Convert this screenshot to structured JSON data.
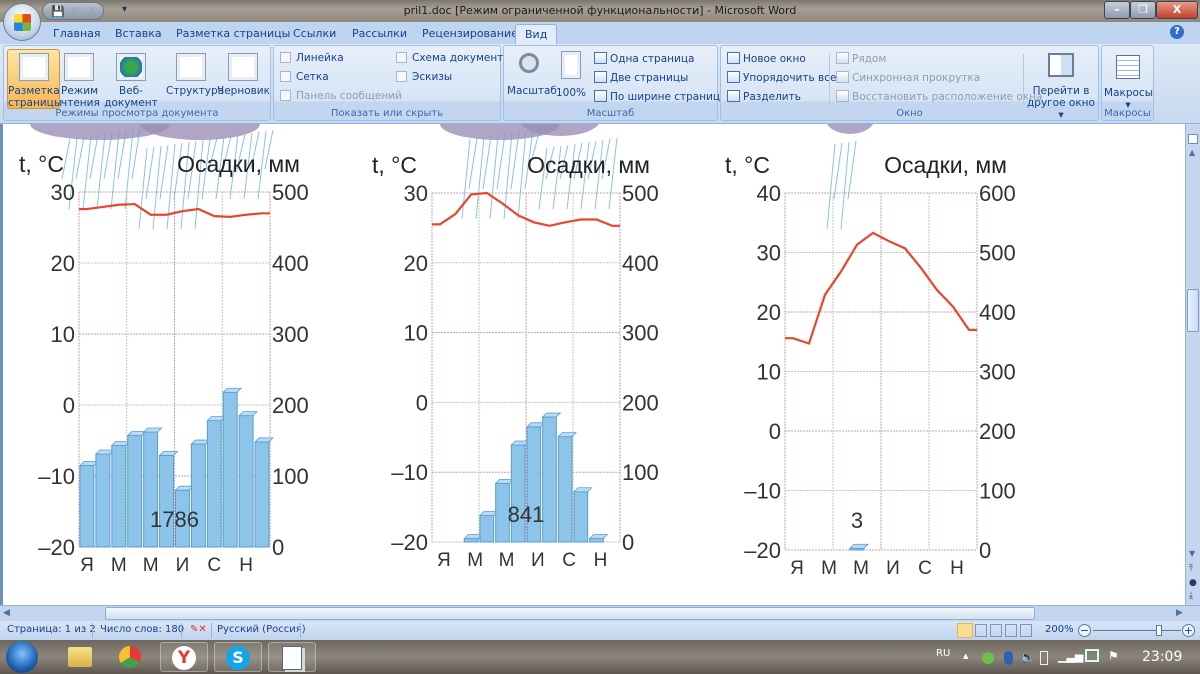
{
  "window": {
    "title": "pril1.doc [Режим ограниченной функциональности] - Microsoft Word",
    "minimize": "–",
    "restore": "❐",
    "close": "X"
  },
  "qat": {
    "save": "💾",
    "undo": "↶",
    "redo": "↻",
    "customize": "▾"
  },
  "tabs": [
    "Главная",
    "Вставка",
    "Разметка страницы",
    "Ссылки",
    "Рассылки",
    "Рецензирование",
    "Вид"
  ],
  "active_tab": "Вид",
  "help": "?",
  "ribbon": {
    "views": {
      "label": "Режимы просмотра документа",
      "buttons": [
        {
          "l1": "Разметка",
          "l2": "страницы",
          "selected": true
        },
        {
          "l1": "Режим",
          "l2": "чтения"
        },
        {
          "l1": "Веб-документ",
          "l2": ""
        },
        {
          "l1": "Структура",
          "l2": ""
        },
        {
          "l1": "Черновик",
          "l2": ""
        }
      ]
    },
    "show": {
      "label": "Показать или скрыть",
      "ruler": "Линейка",
      "grid": "Сетка",
      "messages": "Панель сообщений",
      "docmap": "Схема документа",
      "thumbs": "Эскизы"
    },
    "zoom": {
      "label": "Масштаб",
      "zoom": "Масштаб",
      "p100": "100%",
      "one": "Одна страница",
      "two": "Две страницы",
      "width": "По ширине страницы"
    },
    "window": {
      "label": "Окно",
      "new": "Новое окно",
      "arrange": "Упорядочить все",
      "split": "Разделить",
      "side": "Рядом",
      "sync": "Синхронная прокрутка",
      "reset": "Восстановить расположение окна",
      "switch1": "Перейти в",
      "switch2": "другое окно ▾"
    },
    "macros": {
      "label": "Макросы",
      "button": "Макросы",
      "arrow": "▾"
    }
  },
  "chart_data": [
    {
      "type": "bar+line",
      "ylabel_left": "t, °C",
      "ylabel_right": "Осадки, мм",
      "ylim_left": [
        -20,
        30
      ],
      "yticks_left": [
        "30",
        "20",
        "10",
        "0",
        "–10",
        "–20"
      ],
      "ylim_right": [
        0,
        500
      ],
      "yticks_right": [
        "500",
        "400",
        "300",
        "200",
        "100",
        "0"
      ],
      "month_labels": [
        "Я",
        "М",
        "М",
        "И",
        "С",
        "Н"
      ],
      "temperature": [
        27.6,
        27.9,
        28.2,
        28.3,
        26.8,
        26.8,
        27.3,
        27.6,
        26.6,
        26.5,
        26.8,
        27.0
      ],
      "precipitation": [
        115,
        131,
        143,
        157,
        162,
        129,
        80,
        145,
        178,
        218,
        185,
        148
      ],
      "total": "1786",
      "colors": {
        "line": "#e8452c",
        "bar": "#8cc4ea"
      }
    },
    {
      "type": "bar+line",
      "ylabel_left": "t, °C",
      "ylabel_right": "Осадки, мм",
      "ylim_left": [
        -20,
        30
      ],
      "yticks_left": [
        "30",
        "20",
        "10",
        "0",
        "–10",
        "–20"
      ],
      "ylim_right": [
        0,
        500
      ],
      "yticks_right": [
        "500",
        "400",
        "300",
        "200",
        "100",
        "0"
      ],
      "month_labels": [
        "Я",
        "М",
        "М",
        "И",
        "С",
        "Н"
      ],
      "temperature": [
        25.5,
        27.0,
        29.8,
        30.0,
        28.5,
        26.8,
        25.8,
        25.3,
        25.8,
        26.2,
        26.2,
        25.3
      ],
      "precipitation": [
        0,
        0,
        5,
        38,
        84,
        139,
        165,
        179,
        151,
        72,
        5,
        0
      ],
      "total": "841",
      "colors": {
        "line": "#e8452c",
        "bar": "#8cc4ea"
      }
    },
    {
      "type": "bar+line",
      "ylabel_left": "t, °C",
      "ylabel_right": "Осадки, мм",
      "ylim_left": [
        -20,
        40
      ],
      "yticks_left": [
        "40",
        "30",
        "20",
        "10",
        "0",
        "–10",
        "–20"
      ],
      "ylim_right": [
        0,
        600
      ],
      "yticks_right": [
        "600",
        "500",
        "400",
        "300",
        "200",
        "100",
        "0"
      ],
      "month_labels": [
        "Я",
        "М",
        "М",
        "И",
        "С",
        "Н"
      ],
      "temperature": [
        15.6,
        14.7,
        22.9,
        26.8,
        31.3,
        33.3,
        31.9,
        30.7,
        27.4,
        23.7,
        20.9,
        17.0
      ],
      "precipitation": [
        0,
        0,
        0,
        0,
        3,
        0,
        0,
        0,
        0,
        0,
        0,
        0
      ],
      "total": "3",
      "colors": {
        "line": "#e8452c",
        "bar": "#8cc4ea"
      }
    }
  ],
  "status": {
    "page": "Страница: 1 из 2",
    "words": "Число слов: 180",
    "language": "Русский (Россия)",
    "zoom": "200%",
    "zoom_minus": "−",
    "zoom_plus": "+",
    "zoom_fraction": 0.75
  },
  "taskbar": {
    "lang": "RU",
    "time": "23:09",
    "tray_up": "▲"
  }
}
